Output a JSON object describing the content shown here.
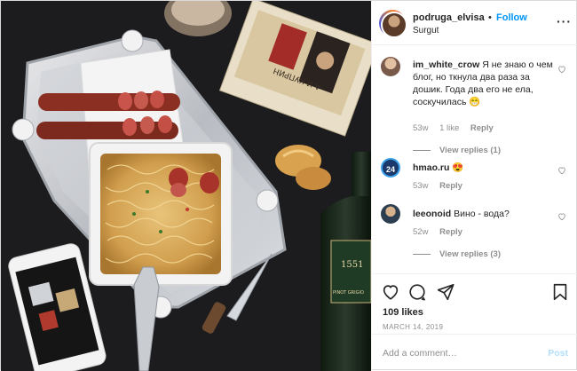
{
  "header": {
    "username": "podruga_elvisa",
    "separator": "•",
    "follow_label": "Follow",
    "location": "Surgut",
    "more_icon": "more-horizontal-icon"
  },
  "comments": [
    {
      "username": "im_white_crow",
      "text": "Я не знаю о чем блог, но ткнула два раза за дошик. Года два его не ела, соскучилась 😁",
      "age": "53w",
      "likes": "1 like",
      "reply_label": "Reply",
      "view_replies": "View replies (1)"
    },
    {
      "username": "hmao.ru",
      "text": "😍",
      "age": "53w",
      "reply_label": "Reply"
    },
    {
      "username": "leeonoid",
      "text": "Вино - вода?",
      "age": "52w",
      "reply_label": "Reply",
      "view_replies": "View replies (3)"
    }
  ],
  "hmao_avatar_text": "24",
  "actions": {
    "like_icon": "heart-icon",
    "comment_icon": "comment-icon",
    "share_icon": "send-icon",
    "save_icon": "bookmark-icon"
  },
  "likes": "109 likes",
  "date": "MARCH 14, 2019",
  "add_comment": {
    "placeholder": "Add a comment…",
    "post_label": "Post"
  },
  "photo": {
    "book_title": "А.И.КУПРИН",
    "wine_label": "1551",
    "wine_sublabel": "PINOT GRIGIO"
  },
  "colors": {
    "follow": "#0095f6",
    "post_disabled": "#b2dffc",
    "muted": "#8e8e8e",
    "photo_background": "#1c1c1e"
  }
}
